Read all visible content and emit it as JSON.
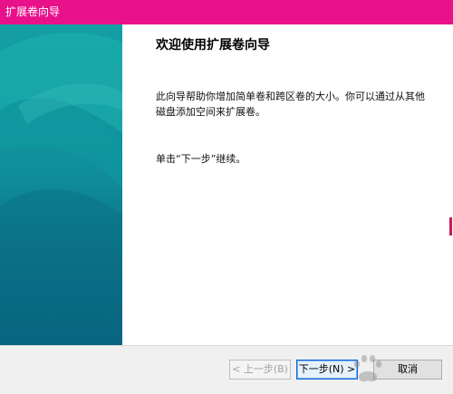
{
  "window": {
    "title": "扩展卷向导"
  },
  "colors": {
    "titlebar": "#e8118a",
    "side_panel_top": "#149fa5",
    "side_panel_bottom": "#085d7b",
    "primary_button_border": "#0a64d8"
  },
  "content": {
    "heading": "欢迎使用扩展卷向导",
    "description": "此向导帮助你增加简单卷和跨区卷的大小。你可以通过从其他磁盘添加空间来扩展卷。",
    "continue_text": "单击“下一步”继续。"
  },
  "footer": {
    "back_label": "< 上一步(B)",
    "next_label": "下一步(N) >",
    "cancel_label": "取消"
  }
}
